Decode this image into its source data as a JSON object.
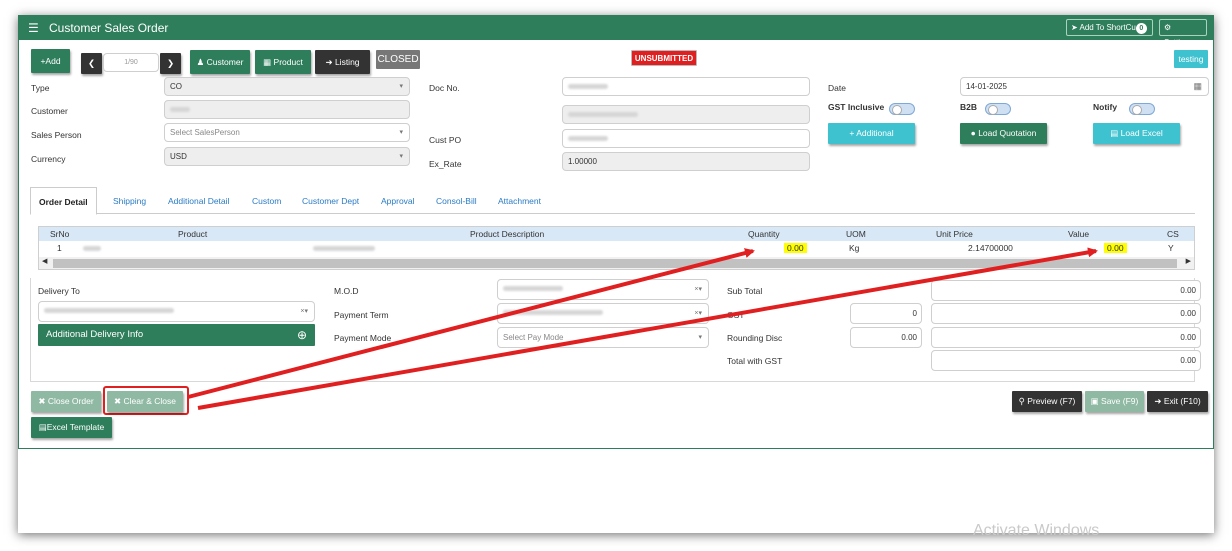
{
  "titlebar": {
    "title": "Customer Sales Order",
    "shortcut_label": "Add To ShortCu",
    "shortcut_count": "0",
    "settings_label": "Settings"
  },
  "toolbar": {
    "add_label": "+Add",
    "nav_value": "1/90",
    "customer_label": "Customer",
    "product_label": "Product",
    "listing_label": "Listing",
    "status_closed": "CLOSED",
    "status_unsubmitted": "UNSUBMITTED",
    "env_label": "testing"
  },
  "form": {
    "type_label": "Type",
    "type_value": "CO",
    "customer_label": "Customer",
    "salesperson_label": "Sales Person",
    "salesperson_placeholder": "Select SalesPerson",
    "currency_label": "Currency",
    "currency_value": "USD",
    "docno_label": "Doc No.",
    "custpo_label": "Cust PO",
    "exrate_label": "Ex_Rate",
    "exrate_value": "1.00000",
    "date_label": "Date",
    "date_value": "14-01-2025",
    "gst_inclusive_label": "GST Inclusive",
    "b2b_label": "B2B",
    "notify_label": "Notify",
    "additional_label": "+ Additional",
    "load_quotation_label": "Load Quotation",
    "load_excel_label": "Load Excel"
  },
  "tabs": [
    "Order Detail",
    "Shipping",
    "Additional Detail",
    "Custom",
    "Customer Dept",
    "Approval",
    "Consol-Bill",
    "Attachment"
  ],
  "grid": {
    "headers": [
      "SrNo",
      "Product",
      "Product Description",
      "Quantity",
      "UOM",
      "Unit Price",
      "Value",
      "CS"
    ],
    "rows": [
      {
        "srno": "1",
        "quantity": "0.00",
        "uom": "Kg",
        "unit_price": "2.14700000",
        "value": "0.00",
        "cs": "Y"
      }
    ]
  },
  "delivery": {
    "delivery_to_label": "Delivery To",
    "additional_info_label": "Additional Delivery Info",
    "mod_label": "M.O.D",
    "payment_term_label": "Payment Term",
    "payment_mode_label": "Payment Mode",
    "payment_mode_placeholder": "Select Pay Mode"
  },
  "totals": {
    "subtotal_label": "Sub Total",
    "subtotal_value": "0.00",
    "gst_label": "GST",
    "gst_rate": "0",
    "gst_value": "0.00",
    "rounding_label": "Rounding Disc",
    "rounding_input": "0.00",
    "rounding_value": "0.00",
    "total_label": "Total with GST",
    "total_value": "0.00"
  },
  "footer": {
    "close_order": "Close Order",
    "clear_close": "Clear & Close",
    "excel_template": "Excel Template",
    "preview": "Preview (F7)",
    "save": "Save (F9)",
    "exit": "Exit (F10)"
  },
  "watermark": "Activate Windows",
  "colors": {
    "primary": "#2e7d5b",
    "accent": "#3fc2cf",
    "danger": "#e02020",
    "highlight": "#ffff00"
  }
}
